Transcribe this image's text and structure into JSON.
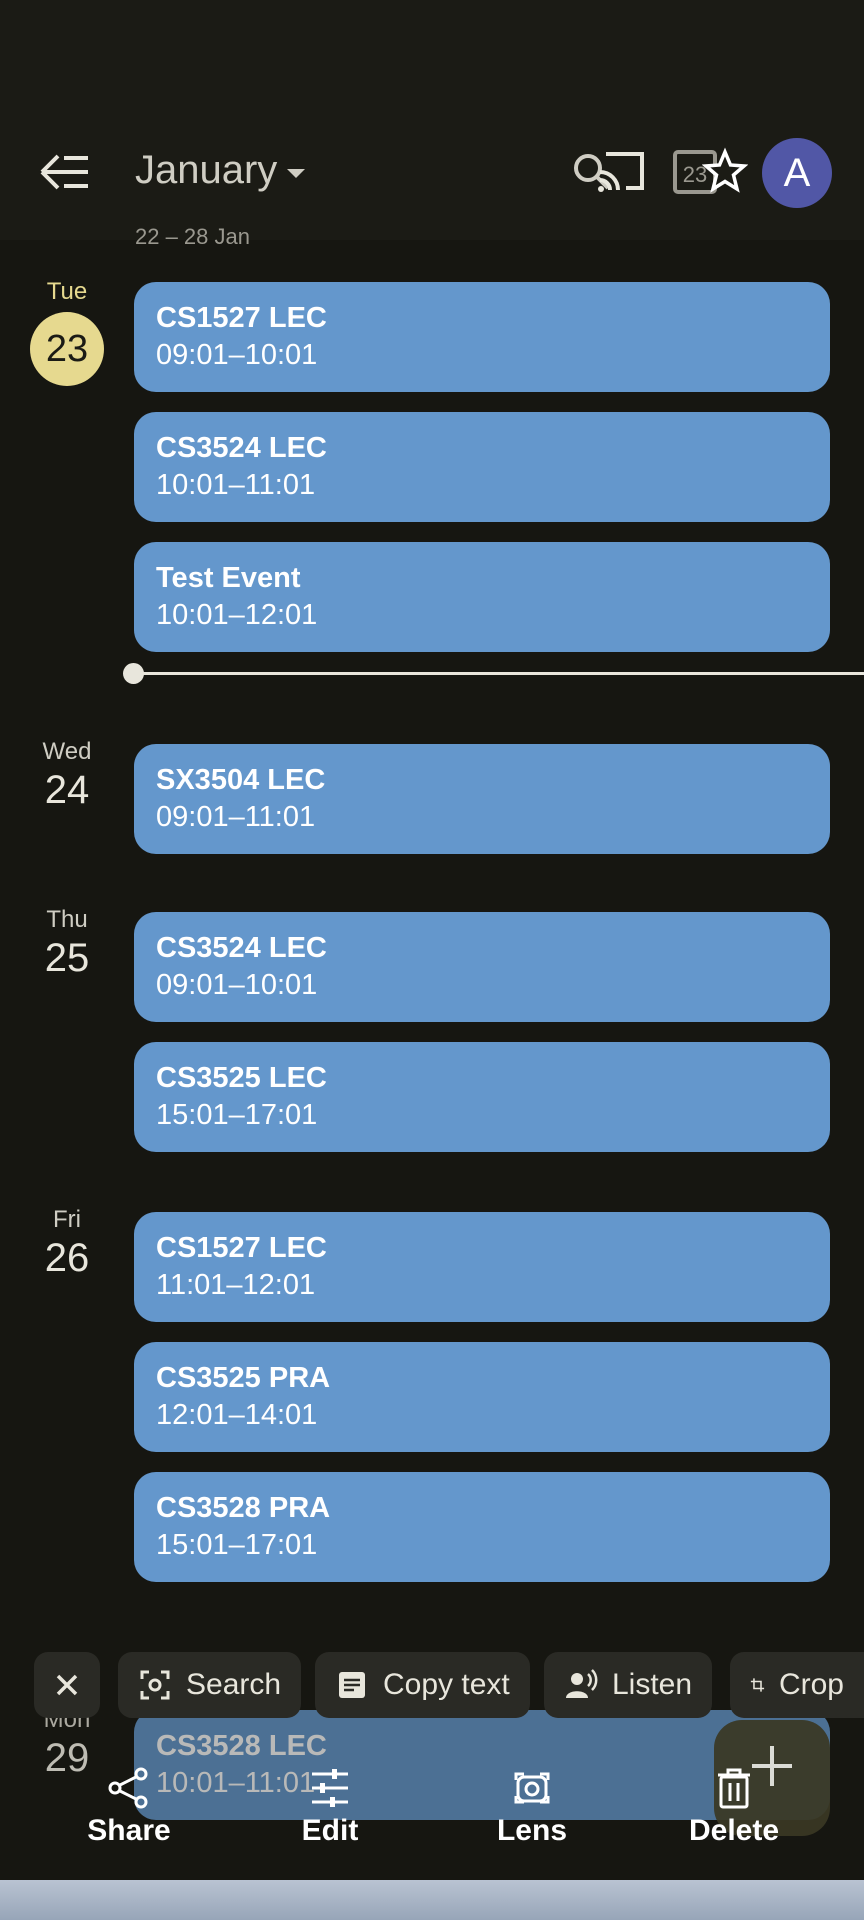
{
  "app_bar": {
    "month_label": "January",
    "avatar_letter": "A",
    "icons": [
      "back-icon",
      "search-icon",
      "cast-icon",
      "today-icon",
      "star-icon",
      "avatar"
    ]
  },
  "week_range": "22 – 28 Jan",
  "days": [
    {
      "dow": "Tue",
      "num": "23",
      "today": true,
      "events": [
        {
          "title": "CS1527 LEC",
          "time": "09:01–10:01"
        },
        {
          "title": "CS3524 LEC",
          "time": "10:01–11:01"
        },
        {
          "title": "Test Event",
          "time": "10:01–12:01"
        }
      ]
    },
    {
      "dow": "Wed",
      "num": "24",
      "events": [
        {
          "title": "SX3504 LEC",
          "time": "09:01–11:01"
        }
      ]
    },
    {
      "dow": "Thu",
      "num": "25",
      "events": [
        {
          "title": "CS3524 LEC",
          "time": "09:01–10:01"
        },
        {
          "title": "CS3525 LEC",
          "time": "15:01–17:01"
        }
      ]
    },
    {
      "dow": "Fri",
      "num": "26",
      "events": [
        {
          "title": "CS1527 LEC",
          "time": "11:01–12:01"
        },
        {
          "title": "CS3525 PRA",
          "time": "12:01–14:01"
        },
        {
          "title": "CS3528 PRA",
          "time": "15:01–17:01"
        }
      ]
    },
    {
      "dow": "Mon",
      "num": "29",
      "events": [
        {
          "title": "CS3528 LEC",
          "time": "10:01–11:01"
        }
      ]
    }
  ],
  "chips": {
    "search": "Search",
    "copy": "Copy text",
    "listen": "Listen",
    "crop": "Crop"
  },
  "bottom_actions": {
    "share": "Share",
    "edit": "Edit",
    "lens": "Lens",
    "delete": "Delete"
  },
  "colors": {
    "event": "#6497cc",
    "today": "#e6d98f",
    "avatar": "#5157a6",
    "background": "#161611"
  }
}
